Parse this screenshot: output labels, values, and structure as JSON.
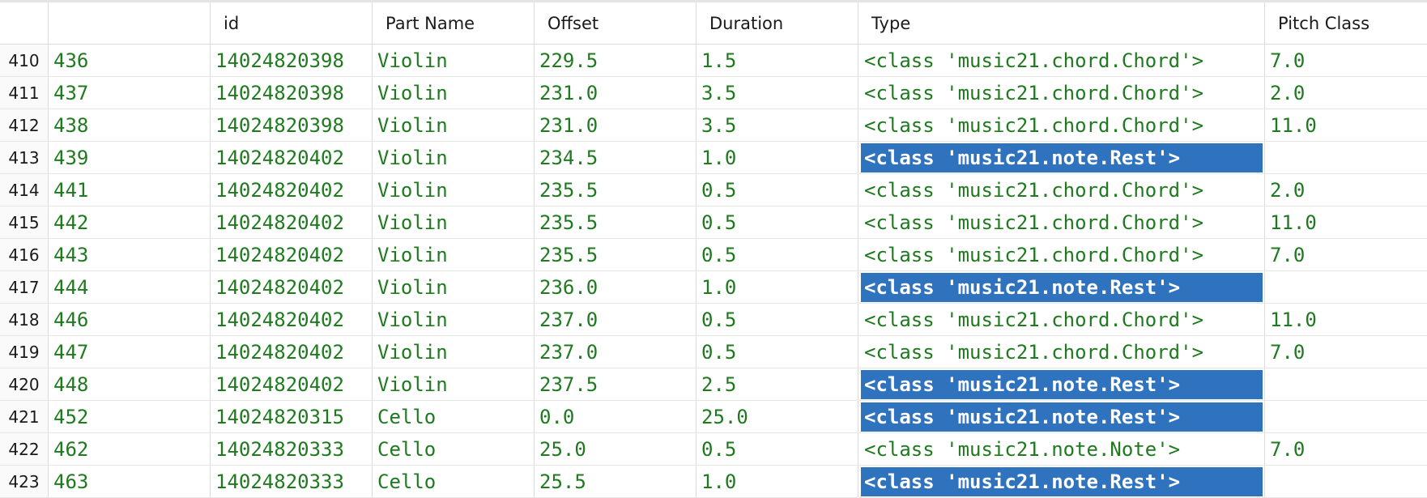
{
  "columns": {
    "rownum": "",
    "index": "",
    "id": "id",
    "part": "Part Name",
    "offset": "Offset",
    "duration": "Duration",
    "type": "Type",
    "pitch": "Pitch Class"
  },
  "highlight_color": "#2f73bf",
  "value_color": "#1f7a1f",
  "rows": [
    {
      "rownum": "410",
      "index": "436",
      "id": "14024820398",
      "part": "Violin",
      "offset": "229.5",
      "duration": "1.5",
      "type": "<class 'music21.chord.Chord'>",
      "pitch": "7.0",
      "highlighted": false
    },
    {
      "rownum": "411",
      "index": "437",
      "id": "14024820398",
      "part": "Violin",
      "offset": "231.0",
      "duration": "3.5",
      "type": "<class 'music21.chord.Chord'>",
      "pitch": "2.0",
      "highlighted": false
    },
    {
      "rownum": "412",
      "index": "438",
      "id": "14024820398",
      "part": "Violin",
      "offset": "231.0",
      "duration": "3.5",
      "type": "<class 'music21.chord.Chord'>",
      "pitch": "11.0",
      "highlighted": false
    },
    {
      "rownum": "413",
      "index": "439",
      "id": "14024820402",
      "part": "Violin",
      "offset": "234.5",
      "duration": "1.0",
      "type": "<class 'music21.note.Rest'>",
      "pitch": "",
      "highlighted": true
    },
    {
      "rownum": "414",
      "index": "441",
      "id": "14024820402",
      "part": "Violin",
      "offset": "235.5",
      "duration": "0.5",
      "type": "<class 'music21.chord.Chord'>",
      "pitch": "2.0",
      "highlighted": false
    },
    {
      "rownum": "415",
      "index": "442",
      "id": "14024820402",
      "part": "Violin",
      "offset": "235.5",
      "duration": "0.5",
      "type": "<class 'music21.chord.Chord'>",
      "pitch": "11.0",
      "highlighted": false
    },
    {
      "rownum": "416",
      "index": "443",
      "id": "14024820402",
      "part": "Violin",
      "offset": "235.5",
      "duration": "0.5",
      "type": "<class 'music21.chord.Chord'>",
      "pitch": "7.0",
      "highlighted": false
    },
    {
      "rownum": "417",
      "index": "444",
      "id": "14024820402",
      "part": "Violin",
      "offset": "236.0",
      "duration": "1.0",
      "type": "<class 'music21.note.Rest'>",
      "pitch": "",
      "highlighted": true
    },
    {
      "rownum": "418",
      "index": "446",
      "id": "14024820402",
      "part": "Violin",
      "offset": "237.0",
      "duration": "0.5",
      "type": "<class 'music21.chord.Chord'>",
      "pitch": "11.0",
      "highlighted": false
    },
    {
      "rownum": "419",
      "index": "447",
      "id": "14024820402",
      "part": "Violin",
      "offset": "237.0",
      "duration": "0.5",
      "type": "<class 'music21.chord.Chord'>",
      "pitch": "7.0",
      "highlighted": false
    },
    {
      "rownum": "420",
      "index": "448",
      "id": "14024820402",
      "part": "Violin",
      "offset": "237.5",
      "duration": "2.5",
      "type": "<class 'music21.note.Rest'>",
      "pitch": "",
      "highlighted": true
    },
    {
      "rownum": "421",
      "index": "452",
      "id": "14024820315",
      "part": "Cello",
      "offset": "0.0",
      "duration": "25.0",
      "type": "<class 'music21.note.Rest'>",
      "pitch": "",
      "highlighted": true
    },
    {
      "rownum": "422",
      "index": "462",
      "id": "14024820333",
      "part": "Cello",
      "offset": "25.0",
      "duration": "0.5",
      "type": "<class 'music21.note.Note'>",
      "pitch": "7.0",
      "highlighted": false
    },
    {
      "rownum": "423",
      "index": "463",
      "id": "14024820333",
      "part": "Cello",
      "offset": "25.5",
      "duration": "1.0",
      "type": "<class 'music21.note.Rest'>",
      "pitch": "",
      "highlighted": true
    }
  ]
}
